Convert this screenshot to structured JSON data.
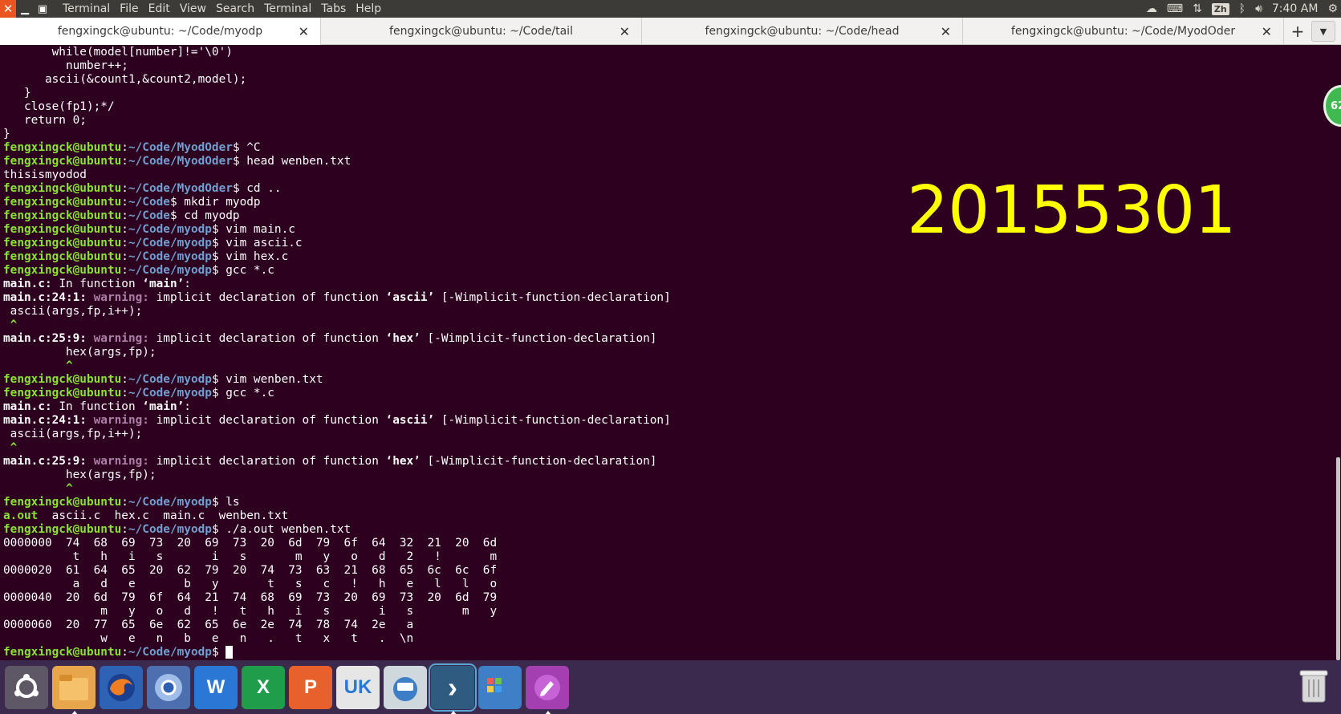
{
  "top_panel": {
    "menus": [
      "Terminal",
      "File",
      "Edit",
      "View",
      "Search",
      "Terminal",
      "Tabs",
      "Help"
    ],
    "input_method": "Zh",
    "time": "7:40 AM"
  },
  "tabs": [
    {
      "title": "fengxingck@ubuntu: ~/Code/myodp",
      "active": true
    },
    {
      "title": "fengxingck@ubuntu: ~/Code/tail",
      "active": false
    },
    {
      "title": "fengxingck@ubuntu: ~/Code/head",
      "active": false
    },
    {
      "title": "fengxingck@ubuntu: ~/Code/MyodOder",
      "active": false
    }
  ],
  "tab_add_label": "+",
  "tab_close_glyph": "✕",
  "overlay_number": "20155301",
  "badge_text": "62",
  "dock": {
    "items": [
      {
        "name": "ubuntu-logo",
        "label": "",
        "bg": "#5e5766"
      },
      {
        "name": "files",
        "label": "",
        "bg": "#e8a64c"
      },
      {
        "name": "firefox",
        "label": "",
        "bg": "#2d62b5"
      },
      {
        "name": "chromium",
        "label": "",
        "bg": "#4d6fb0"
      },
      {
        "name": "wps-writer",
        "label": "W",
        "bg": "#2a77d6"
      },
      {
        "name": "wps-spreadsheets",
        "label": "X",
        "bg": "#1f9d4a"
      },
      {
        "name": "wps-presentation",
        "label": "P",
        "bg": "#e8612c"
      },
      {
        "name": "ubuntu-kylin",
        "label": "UK",
        "bg": "#e6e6e6"
      },
      {
        "name": "software-updater",
        "label": "",
        "bg": "#cfd8dc"
      },
      {
        "name": "terminal-app",
        "label": "›",
        "bg": "#2f5b80"
      },
      {
        "name": "workspaces",
        "label": "",
        "bg": "#3e7fc7"
      },
      {
        "name": "text-editor",
        "label": "",
        "bg": "#a33fb0"
      }
    ]
  },
  "terminal": {
    "user": "fengxingck@ubuntu",
    "lines": [
      {
        "type": "plain",
        "text": "       while(model[number]!='\\0')"
      },
      {
        "type": "plain",
        "text": "         number++;"
      },
      {
        "type": "plain",
        "text": "      ascii(&count1,&count2,model);"
      },
      {
        "type": "plain",
        "text": "   }"
      },
      {
        "type": "plain",
        "text": "   close(fp1);*/"
      },
      {
        "type": "plain",
        "text": "   return 0;"
      },
      {
        "type": "plain",
        "text": "}"
      },
      {
        "type": "prompt",
        "path": "~/Code/MyodOder",
        "cmd": " ^C"
      },
      {
        "type": "prompt",
        "path": "~/Code/MyodOder",
        "cmd": " head wenben.txt"
      },
      {
        "type": "plain",
        "text": "thisismyodod"
      },
      {
        "type": "prompt",
        "path": "~/Code/MyodOder",
        "cmd": " cd .."
      },
      {
        "type": "prompt",
        "path": "~/Code",
        "cmd": " mkdir myodp"
      },
      {
        "type": "prompt",
        "path": "~/Code",
        "cmd": " cd myodp"
      },
      {
        "type": "prompt",
        "path": "~/Code/myodp",
        "cmd": " vim main.c"
      },
      {
        "type": "prompt",
        "path": "~/Code/myodp",
        "cmd": " vim ascii.c"
      },
      {
        "type": "prompt",
        "path": "~/Code/myodp",
        "cmd": " vim hex.c"
      },
      {
        "type": "prompt",
        "path": "~/Code/myodp",
        "cmd": " gcc *.c"
      },
      {
        "type": "infunc",
        "file": "main.c:",
        "text": " In function ",
        "func": "‘main’",
        "tail": ":"
      },
      {
        "type": "warn",
        "loc": "main.c:24:1:",
        "w": " warning:",
        "text": " implicit declaration of function ",
        "func": "‘ascii’",
        "tail": " [-Wimplicit-function-declaration]"
      },
      {
        "type": "plain",
        "text": " ascii(args,fp,i++);"
      },
      {
        "type": "caret",
        "text": " ^"
      },
      {
        "type": "warn",
        "loc": "main.c:25:9:",
        "w": " warning:",
        "text": " implicit declaration of function ",
        "func": "‘hex’",
        "tail": " [-Wimplicit-function-declaration]"
      },
      {
        "type": "plain",
        "text": "         hex(args,fp);"
      },
      {
        "type": "caret",
        "text": "         ^"
      },
      {
        "type": "prompt",
        "path": "~/Code/myodp",
        "cmd": " vim wenben.txt"
      },
      {
        "type": "prompt",
        "path": "~/Code/myodp",
        "cmd": " gcc *.c"
      },
      {
        "type": "infunc",
        "file": "main.c:",
        "text": " In function ",
        "func": "‘main’",
        "tail": ":"
      },
      {
        "type": "warn",
        "loc": "main.c:24:1:",
        "w": " warning:",
        "text": " implicit declaration of function ",
        "func": "‘ascii’",
        "tail": " [-Wimplicit-function-declaration]"
      },
      {
        "type": "plain",
        "text": " ascii(args,fp,i++);"
      },
      {
        "type": "caret",
        "text": " ^"
      },
      {
        "type": "warn",
        "loc": "main.c:25:9:",
        "w": " warning:",
        "text": " implicit declaration of function ",
        "func": "‘hex’",
        "tail": " [-Wimplicit-function-declaration]"
      },
      {
        "type": "plain",
        "text": "         hex(args,fp);"
      },
      {
        "type": "caret",
        "text": "         ^"
      },
      {
        "type": "prompt",
        "path": "~/Code/myodp",
        "cmd": " ls"
      },
      {
        "type": "ls",
        "exe": "a.out",
        "text": "  ascii.c  hex.c  main.c  wenben.txt"
      },
      {
        "type": "prompt",
        "path": "~/Code/myodp",
        "cmd": " ./a.out wenben.txt"
      },
      {
        "type": "plain",
        "text": "0000000  74  68  69  73  20  69  73  20  6d  79  6f  64  32  21  20  6d"
      },
      {
        "type": "plain",
        "text": "          t   h   i   s       i   s       m   y   o   d   2   !       m"
      },
      {
        "type": "plain",
        "text": "0000020  61  64  65  20  62  79  20  74  73  63  21  68  65  6c  6c  6f"
      },
      {
        "type": "plain",
        "text": "          a   d   e       b   y       t   s   c   !   h   e   l   l   o"
      },
      {
        "type": "plain",
        "text": "0000040  20  6d  79  6f  64  21  74  68  69  73  20  69  73  20  6d  79"
      },
      {
        "type": "plain",
        "text": "              m   y   o   d   !   t   h   i   s       i   s       m   y"
      },
      {
        "type": "plain",
        "text": "0000060  20  77  65  6e  62  65  6e  2e  74  78  74  2e   a"
      },
      {
        "type": "plain",
        "text": "              w   e   n   b   e   n   .   t   x   t   .  \\n"
      },
      {
        "type": "prompt",
        "path": "~/Code/myodp",
        "cmd": " ",
        "cursor": true
      }
    ]
  }
}
